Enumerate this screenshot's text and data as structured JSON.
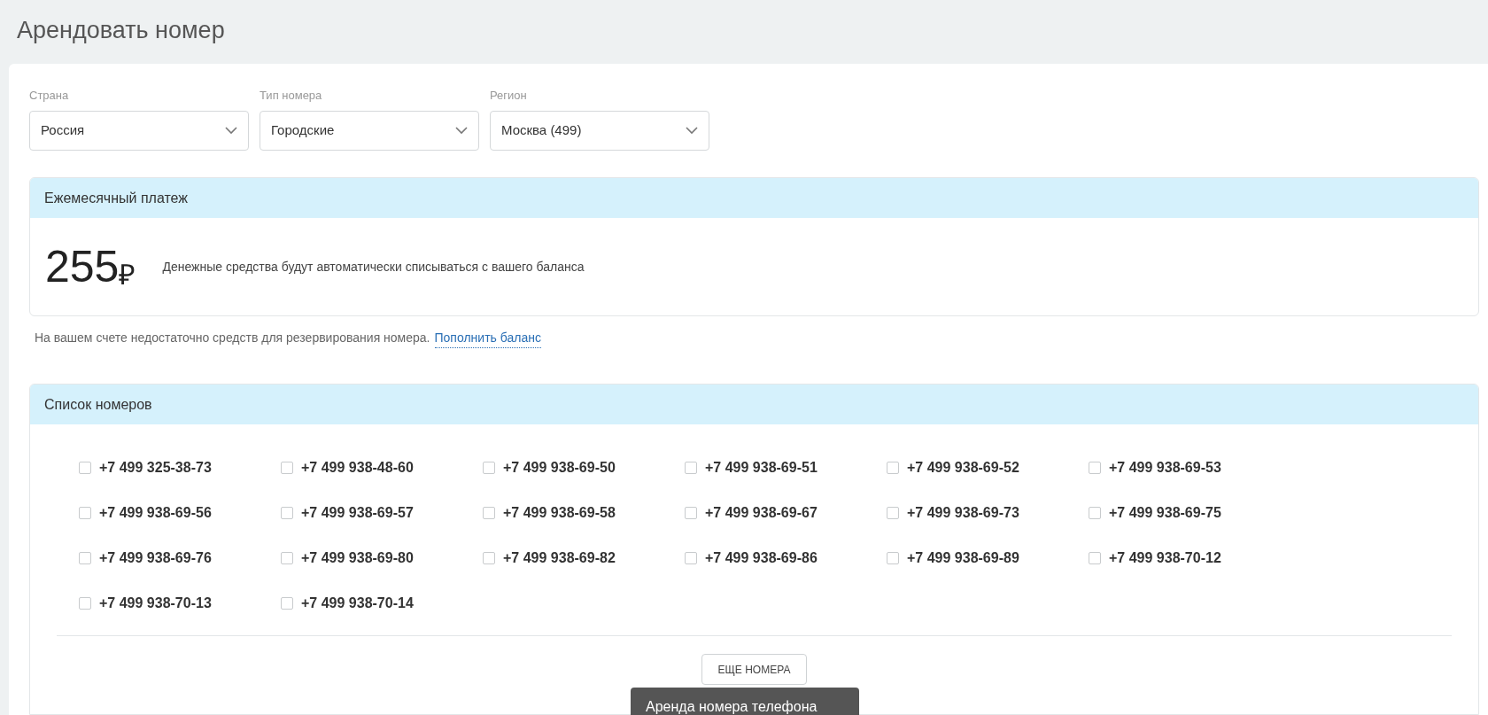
{
  "page_title": "Арендовать номер",
  "filters": [
    {
      "label": "Страна",
      "value": "Россия"
    },
    {
      "label": "Тип номера",
      "value": "Городские"
    },
    {
      "label": "Регион",
      "value": "Москва (499)"
    }
  ],
  "monthly_payment": {
    "heading": "Ежемесячный платеж",
    "amount": "255",
    "currency": "₽",
    "description": "Денежные средства будут автоматически списываться с вашего баланса"
  },
  "balance_notice": {
    "text": "На вашем счете недостаточно средств для резервирования номера.",
    "link": "Пополнить баланс"
  },
  "number_list": {
    "heading": "Список номеров",
    "numbers": [
      {
        "number": "+7 499 325-38-73",
        "checked": false
      },
      {
        "number": "+7 499 938-48-60",
        "checked": false
      },
      {
        "number": "+7 499 938-69-50",
        "checked": false
      },
      {
        "number": "+7 499 938-69-51",
        "checked": false
      },
      {
        "number": "+7 499 938-69-52",
        "checked": false
      },
      {
        "number": "+7 499 938-69-53",
        "checked": false
      },
      {
        "number": "+7 499 938-69-56",
        "checked": false
      },
      {
        "number": "+7 499 938-69-57",
        "checked": false
      },
      {
        "number": "+7 499 938-69-58",
        "checked": false
      },
      {
        "number": "+7 499 938-69-67",
        "checked": false
      },
      {
        "number": "+7 499 938-69-73",
        "checked": false
      },
      {
        "number": "+7 499 938-69-75",
        "checked": false
      },
      {
        "number": "+7 499 938-69-76",
        "checked": false
      },
      {
        "number": "+7 499 938-69-80",
        "checked": false
      },
      {
        "number": "+7 499 938-69-82",
        "checked": false
      },
      {
        "number": "+7 499 938-69-86",
        "checked": false
      },
      {
        "number": "+7 499 938-69-89",
        "checked": false
      },
      {
        "number": "+7 499 938-70-12",
        "checked": false
      },
      {
        "number": "+7 499 938-70-13",
        "checked": false
      },
      {
        "number": "+7 499 938-70-14",
        "checked": false
      }
    ],
    "more_button": "ЕЩЕ НОМЕРА"
  },
  "tooltip": "Аренда номера телефона"
}
